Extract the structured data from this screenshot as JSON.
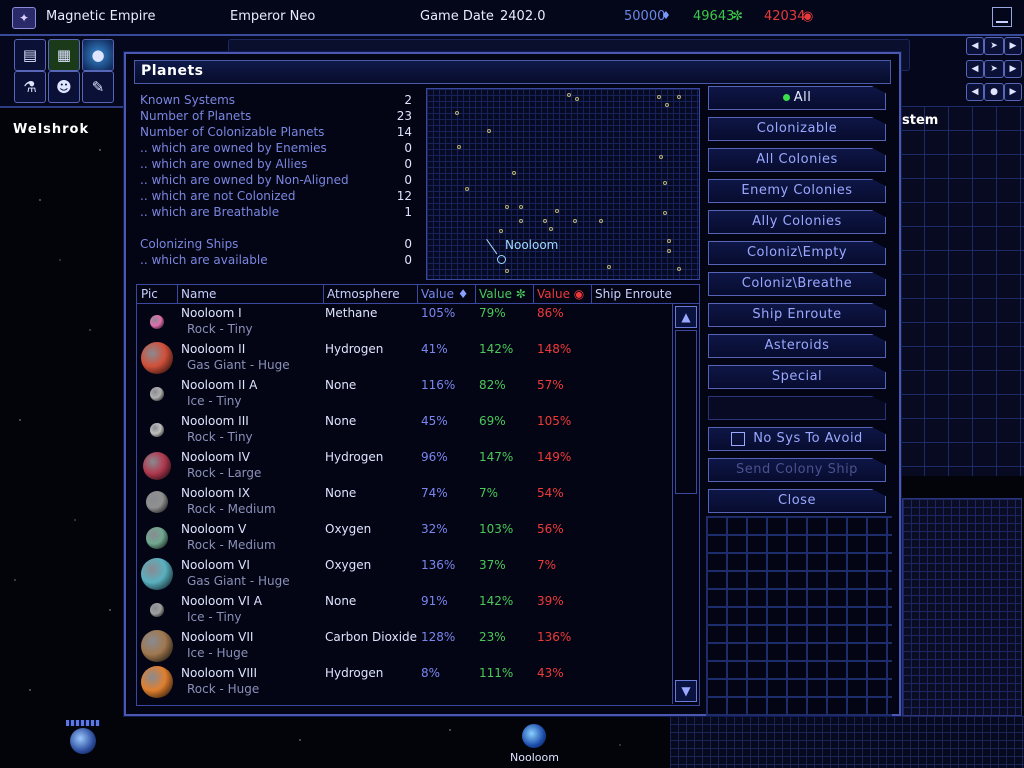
{
  "topbar": {
    "empire_name": "Magnetic Empire",
    "leader": "Emperor Neo",
    "game_date_label": "Game Date",
    "game_date": "2402.0",
    "res1_value": "50000",
    "res2_value": "49643",
    "res3_value": "42034",
    "res_colors": [
      "#5a7ad8",
      "#3ac84a",
      "#e83a3a"
    ]
  },
  "sidebar": {
    "system_name": "Welshrok"
  },
  "rightpanel": {
    "label": "stem"
  },
  "bottom": {
    "planet_label": "Nooloom"
  },
  "dialog": {
    "title": "Planets",
    "stats": [
      {
        "label": "Known Systems",
        "value": "2"
      },
      {
        "label": "Number of Planets",
        "value": "23"
      },
      {
        "label": "Number of Colonizable Planets",
        "value": "14"
      },
      {
        "label": ".. which are owned by Enemies",
        "value": "0"
      },
      {
        "label": ".. which are owned by Allies",
        "value": "0"
      },
      {
        "label": ".. which are owned by Non-Aligned",
        "value": "0"
      },
      {
        "label": ".. which are not Colonized",
        "value": "12"
      },
      {
        "label": ".. which are Breathable",
        "value": "1"
      }
    ],
    "ship_stats": [
      {
        "label": "Colonizing Ships",
        "value": "0"
      },
      {
        "label": ".. which are available",
        "value": "0"
      }
    ],
    "map": {
      "current_system": "Nooloom"
    },
    "columns": {
      "pic": "Pic",
      "name": "Name",
      "atmosphere": "Atmosphere",
      "value1": "Value",
      "value2": "Value",
      "value3": "Value",
      "ship_enroute": "Ship Enroute"
    },
    "planets": [
      {
        "name": "Nooloom I",
        "type": "Rock - Tiny",
        "atmosphere": "Methane",
        "v1": "105%",
        "v2": "79%",
        "v3": "86%",
        "color": "#e070b0",
        "size": "tiny"
      },
      {
        "name": "Nooloom II",
        "type": "Gas Giant - Huge",
        "atmosphere": "Hydrogen",
        "v1": "41%",
        "v2": "142%",
        "v3": "148%",
        "color": "#d0503a",
        "size": "huge"
      },
      {
        "name": "Nooloom II A",
        "type": "Ice - Tiny",
        "atmosphere": "None",
        "v1": "116%",
        "v2": "82%",
        "v3": "57%",
        "color": "#b0b0b0",
        "size": "tiny"
      },
      {
        "name": "Nooloom III",
        "type": "Rock - Tiny",
        "atmosphere": "None",
        "v1": "45%",
        "v2": "69%",
        "v3": "105%",
        "color": "#c0c0c0",
        "size": "tiny"
      },
      {
        "name": "Nooloom IV",
        "type": "Rock - Large",
        "atmosphere": "Hydrogen",
        "v1": "96%",
        "v2": "147%",
        "v3": "149%",
        "color": "#b03a50",
        "size": "large"
      },
      {
        "name": "Nooloom IX",
        "type": "Rock - Medium",
        "atmosphere": "None",
        "v1": "74%",
        "v2": "7%",
        "v3": "54%",
        "color": "#909090",
        "size": "medium"
      },
      {
        "name": "Nooloom V",
        "type": "Rock - Medium",
        "atmosphere": "Oxygen",
        "v1": "32%",
        "v2": "103%",
        "v3": "56%",
        "color": "#70a890",
        "size": "medium"
      },
      {
        "name": "Nooloom VI",
        "type": "Gas Giant - Huge",
        "atmosphere": "Oxygen",
        "v1": "136%",
        "v2": "37%",
        "v3": "7%",
        "color": "#5ab0c0",
        "size": "huge"
      },
      {
        "name": "Nooloom VI A",
        "type": "Ice - Tiny",
        "atmosphere": "None",
        "v1": "91%",
        "v2": "142%",
        "v3": "39%",
        "color": "#a0a0a0",
        "size": "tiny"
      },
      {
        "name": "Nooloom VII",
        "type": "Ice - Huge",
        "atmosphere": "Carbon Dioxide",
        "v1": "128%",
        "v2": "23%",
        "v3": "136%",
        "color": "#a07850",
        "size": "huge"
      },
      {
        "name": "Nooloom VIII",
        "type": "Rock - Huge",
        "atmosphere": "Hydrogen",
        "v1": "8%",
        "v2": "111%",
        "v3": "43%",
        "color": "#e08030",
        "size": "huge"
      }
    ],
    "filters": {
      "all": "All",
      "colonizable": "Colonizable",
      "all_colonies": "All Colonies",
      "enemy_colonies": "Enemy Colonies",
      "ally_colonies": "Ally Colonies",
      "coloniz_empty": "Coloniz\\Empty",
      "coloniz_breathe": "Coloniz\\Breathe",
      "ship_enroute": "Ship Enroute",
      "asteroids": "Asteroids",
      "special": "Special",
      "no_sys_to_avoid": "No Sys To Avoid",
      "send_colony_ship": "Send Colony Ship",
      "close": "Close"
    }
  }
}
